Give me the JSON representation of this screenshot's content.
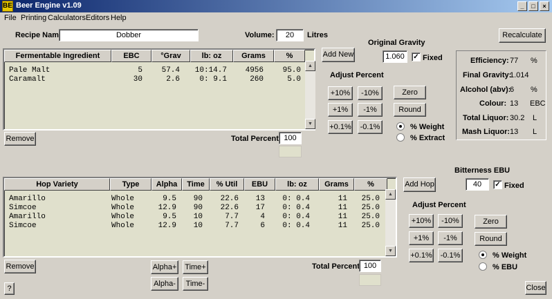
{
  "window": {
    "title": "Beer Engine v1.09",
    "icon": "BE",
    "min": "_",
    "max": "□",
    "close": "×"
  },
  "menu": [
    "File",
    "Printing",
    "Calculators",
    "Editors",
    "Help"
  ],
  "recipe": {
    "name_label": "Recipe Name:",
    "name": "Dobber",
    "volume_label": "Volume:",
    "volume": "20",
    "volume_unit": "Litres"
  },
  "og": {
    "title": "Original Gravity",
    "value": "1.060",
    "fixed_label": "Fixed",
    "fixed": "✓"
  },
  "recalc_label": "Recalculate",
  "stats": [
    {
      "label": "Efficiency:",
      "value": "77",
      "unit": "%"
    },
    {
      "label": "Final Gravity:",
      "value": "1.014",
      "unit": ""
    },
    {
      "label": "Alcohol (abv):",
      "value": "6",
      "unit": "%"
    },
    {
      "label": "Colour:",
      "value": "13",
      "unit": "EBC"
    },
    {
      "label": "Total Liquor:",
      "value": "30.2",
      "unit": "L"
    },
    {
      "label": "Mash Liquor:",
      "value": "13",
      "unit": "L"
    }
  ],
  "ferm": {
    "headers": [
      "Fermentable Ingredient",
      "EBC",
      "°Grav",
      "lb: oz",
      "Grams",
      "%"
    ],
    "rows": [
      [
        "Pale Malt",
        "5",
        "57.4",
        "10:14.7",
        "4956",
        "95.0"
      ],
      [
        "Caramalt",
        "30",
        "2.6",
        "0: 9.1",
        "260",
        "5.0"
      ]
    ],
    "remove_label": "Remove",
    "add_label": "Add New",
    "total_label": "Total Percent:",
    "total": "100",
    "adjust_title": "Adjust Percent",
    "adj": [
      "+10%",
      "-10%",
      "+1%",
      "-1%",
      "+0.1%",
      "-0.1%"
    ],
    "zero_label": "Zero",
    "round_label": "Round",
    "radio_weight": "% Weight",
    "radio_extract": "% Extract"
  },
  "hops": {
    "bitterness_title": "Bitterness EBU",
    "bitterness": "40",
    "fixed_label": "Fixed",
    "fixed": "✓",
    "headers": [
      "Hop Variety",
      "Type",
      "Alpha",
      "Time",
      "% Util",
      "EBU",
      "lb: oz",
      "Grams",
      "%"
    ],
    "rows": [
      [
        "Amarillo",
        "Whole",
        "9.5",
        "90",
        "22.6",
        "13",
        "0: 0.4",
        "11",
        "25.0"
      ],
      [
        "Simcoe",
        "Whole",
        "12.9",
        "90",
        "22.6",
        "17",
        "0: 0.4",
        "11",
        "25.0"
      ],
      [
        "Amarillo",
        "Whole",
        "9.5",
        "10",
        "7.7",
        "4",
        "0: 0.4",
        "11",
        "25.0"
      ],
      [
        "Simcoe",
        "Whole",
        "12.9",
        "10",
        "7.7",
        "6",
        "0: 0.4",
        "11",
        "25.0"
      ]
    ],
    "remove_label": "Remove",
    "add_label": "Add Hop",
    "alpha_plus": "Alpha+",
    "alpha_minus": "Alpha-",
    "time_plus": "Time+",
    "time_minus": "Time-",
    "total_label": "Total Percent:",
    "total": "100",
    "adjust_title": "Adjust Percent",
    "adj": [
      "+10%",
      "-10%",
      "+1%",
      "-1%",
      "+0.1%",
      "-0.1%"
    ],
    "zero_label": "Zero",
    "round_label": "Round",
    "radio_weight": "% Weight",
    "radio_ebu": "% EBU"
  },
  "help_label": "?",
  "close_label": "Close",
  "scroll": {
    "up": "▲",
    "down": "▼"
  }
}
